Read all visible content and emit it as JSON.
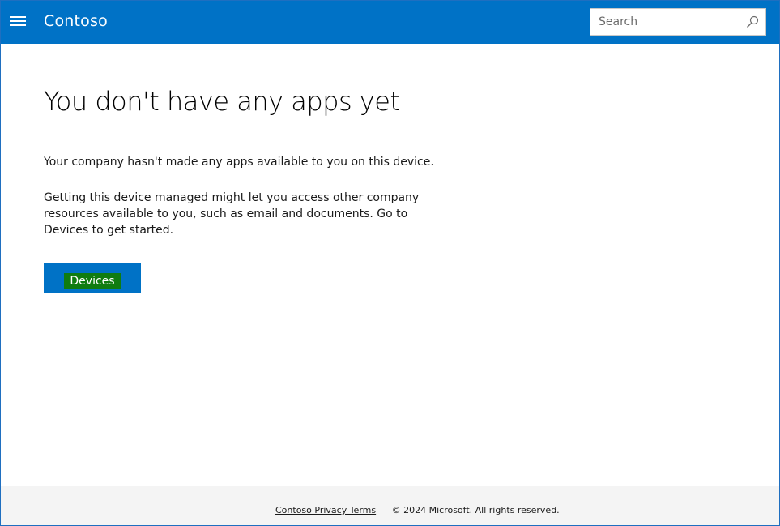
{
  "header": {
    "brand": "Contoso",
    "search_placeholder": "Search",
    "menu_icon": "hamburger-menu-icon",
    "search_icon": "search-icon"
  },
  "main": {
    "title": "You don't have any apps yet",
    "paragraph1": "Your company hasn't made any apps available to you on this device.",
    "paragraph2": "Getting this device managed might let you access other company resources available to you, such as email and documents. Go to Devices to get started.",
    "devices_button_label": "Devices"
  },
  "footer": {
    "privacy_link": "Contoso Privacy Terms",
    "copyright": "© 2024 Microsoft. All rights reserved."
  },
  "colors": {
    "accent": "#0072c6",
    "button_label_highlight": "#107c10",
    "footer_bg": "#f4f4f4"
  }
}
